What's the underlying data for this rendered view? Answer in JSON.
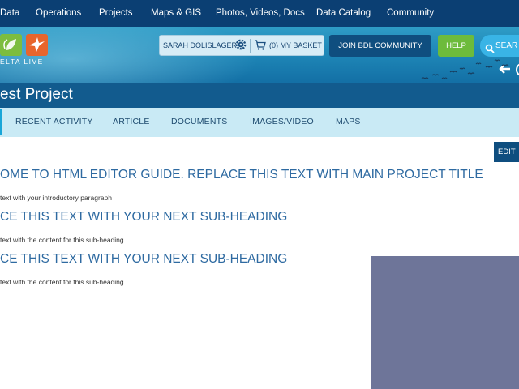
{
  "topnav": {
    "items": [
      "Data",
      "Operations",
      "Projects",
      "Maps & GIS",
      "Photos, Videos, Docs",
      "Data Catalog",
      "Community"
    ]
  },
  "header": {
    "logo_text": "ELTA LIVE",
    "user_name": "SARAH DOLISLAGER",
    "basket_label": "(0) MY BASKET",
    "join_label": "JOIN BDL COMMUNITY",
    "help_label": "HELP",
    "search_label": "SEAR"
  },
  "page": {
    "title": "est Project"
  },
  "tabs": [
    "RECENT ACTIVITY",
    "ARTICLE",
    "DOCUMENTS",
    "IMAGES/VIDEO",
    "MAPS"
  ],
  "content": {
    "edit_label": "EDIT",
    "heading1": "OME TO HTML EDITOR GUIDE. REPLACE THIS TEXT WITH MAIN PROJECT TITLE",
    "para1": "text with your introductory paragraph",
    "heading2": "CE THIS TEXT WITH YOUR NEXT SUB-HEADING",
    "para2": "text with the content for this sub-heading",
    "heading3": "CE THIS TEXT WITH YOUR NEXT SUB-HEADING",
    "para3": "text with the content for this sub-heading"
  },
  "colors": {
    "nav": "#0b3f73",
    "title_band": "#125b8e",
    "tab_bar": "#c9eaf5",
    "heading": "#2e6aa1",
    "help": "#6dbb3b",
    "search": "#39b4e6",
    "media_placeholder": "#6e7599"
  },
  "icons": [
    "gear-icon",
    "cart-icon",
    "search-icon",
    "back-arrow-icon",
    "logo-leaf-icon",
    "logo-bird-icon"
  ]
}
